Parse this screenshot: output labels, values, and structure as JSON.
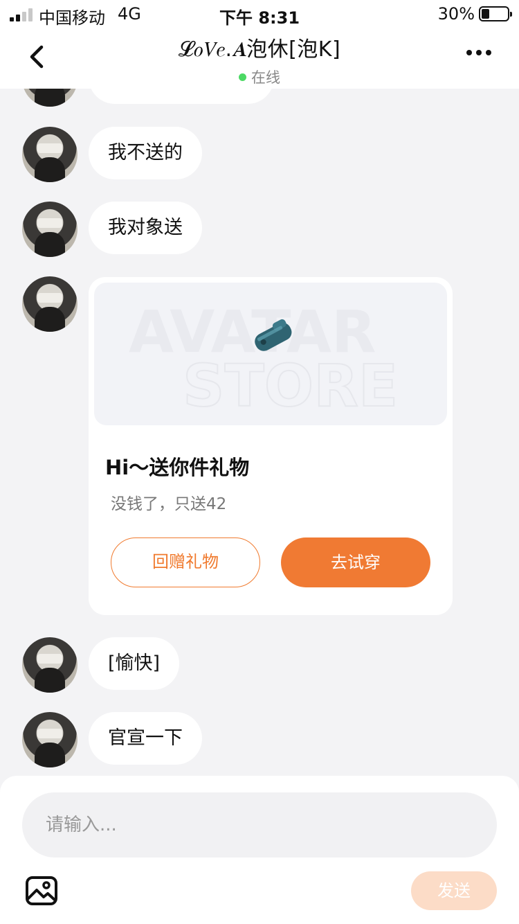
{
  "status_bar": {
    "carrier": "中国移动",
    "network": "4G",
    "time": "下午 8:31",
    "battery_percent": "30%",
    "battery_level": 0.3
  },
  "header": {
    "title": "𝓛𝑜𝑉𝑒.𝑨泡休[泡K]",
    "status": "在线"
  },
  "messages": [
    {
      "text": "我不送的"
    },
    {
      "text": "我对象送"
    },
    {
      "text": "[愉快]"
    },
    {
      "text": "官宣一下"
    }
  ],
  "gift_card": {
    "watermark_line1": "AVATAR",
    "watermark_line2": "STORE",
    "title": "Hi～送你件礼物",
    "subtitle": "没钱了，只送42",
    "return_button": "回赠礼物",
    "try_button": "去试穿"
  },
  "composer": {
    "placeholder": "请输入...",
    "send_label": "发送"
  },
  "colors": {
    "accent": "#f07a33",
    "online": "#4cd964",
    "send_disabled": "#fcdcc7"
  }
}
